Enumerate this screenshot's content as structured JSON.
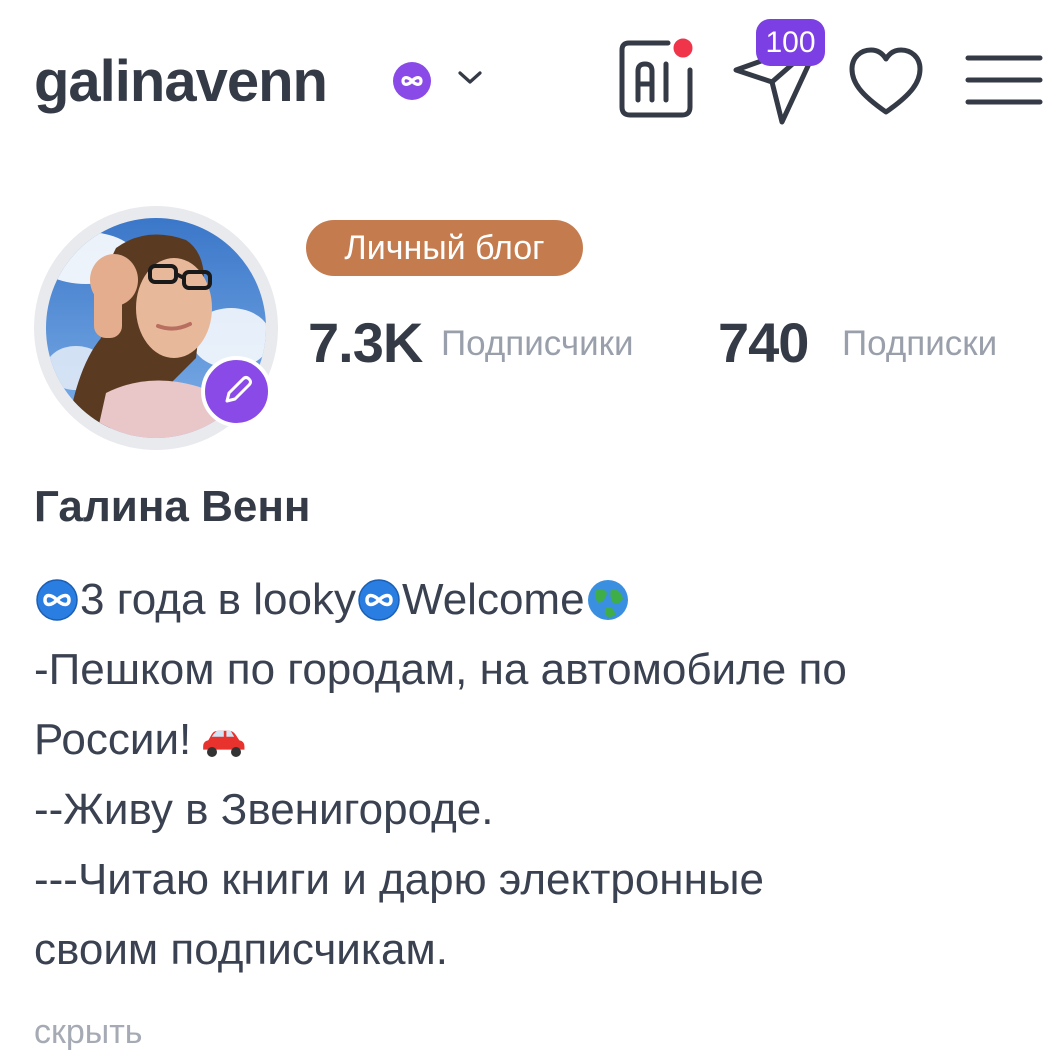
{
  "header": {
    "username": "galinavenn",
    "verified_icon": "infinity-verified-icon",
    "dropdown_icon": "chevron-down-icon",
    "ai_button": {
      "label": "AI",
      "icon": "ai-icon",
      "has_notification_dot": true,
      "dot_color": "#f0354b"
    },
    "send_button": {
      "icon": "paper-plane-icon",
      "badge": "100",
      "badge_color": "#7b3fe4"
    },
    "heart_button": {
      "icon": "heart-icon"
    },
    "menu_button": {
      "icon": "hamburger-menu-icon"
    }
  },
  "profile": {
    "avatar_icon": "avatar",
    "edit_icon": "pencil-icon",
    "edit_color": "#8a4ae8",
    "blog_badge": "Личный блог",
    "blog_badge_color": "#c47c4f",
    "followers_count": "7.3K",
    "followers_label": "Подписчики",
    "following_count": "740",
    "following_label": "Подписки"
  },
  "bio": {
    "display_name": "Галина Венн",
    "lines": [
      {
        "parts": [
          "3 года в looky",
          "Welcome"
        ],
        "emoji": [
          "infinity-emoji",
          "infinity-emoji",
          "globe-emoji"
        ]
      },
      {
        "text": "-Пешком по городам, на автомобиле по"
      },
      {
        "text": "России! ",
        "emoji": [
          "car-emoji"
        ]
      },
      {
        "text": "--Живу в Звенигороде."
      },
      {
        "text": "---Читаю книги и дарю электронные"
      },
      {
        "text": "своим подписчикам."
      }
    ],
    "hide_link": "скрыть"
  },
  "colors": {
    "text_primary": "#343a46",
    "text_secondary": "#9aa0ab",
    "accent_purple": "#8a4ae8"
  }
}
